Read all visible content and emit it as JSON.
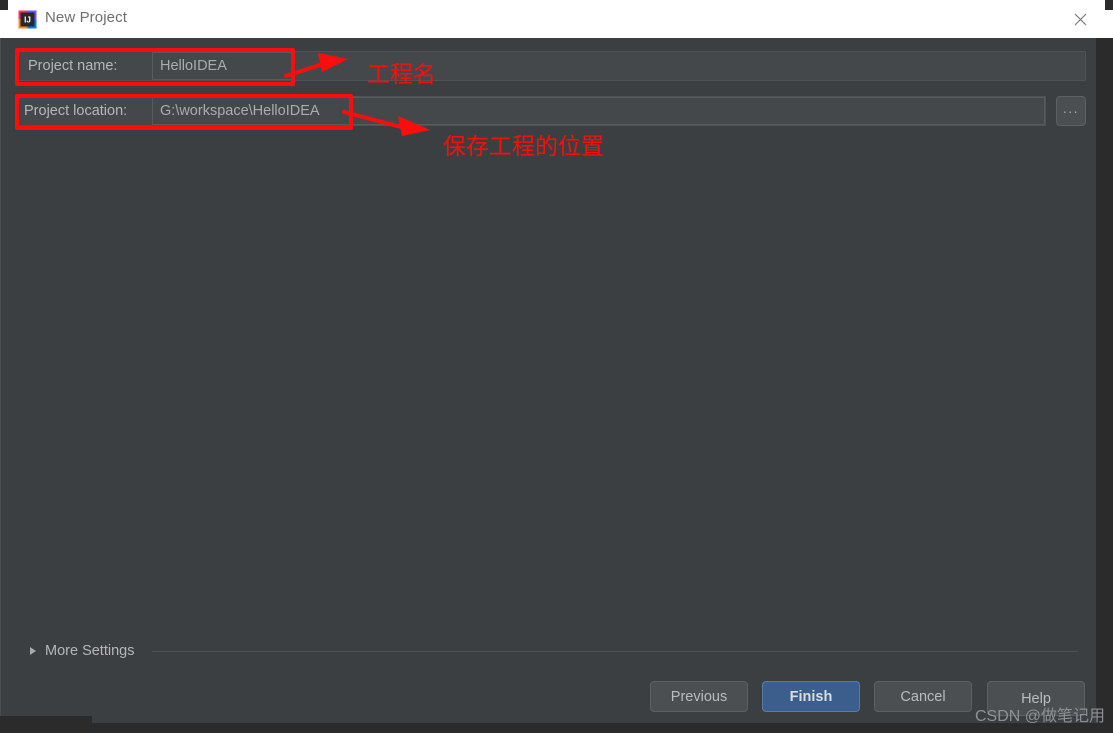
{
  "window": {
    "title": "New Project",
    "app_icon": "intellij-idea-icon",
    "close_icon": "close-icon"
  },
  "form": {
    "project_name": {
      "label": "Project name:",
      "value": "HelloIDEA",
      "placeholder": ""
    },
    "project_location": {
      "label": "Project location:",
      "value": "G:\\workspace\\HelloIDEA",
      "placeholder": "",
      "browse_label": "..."
    }
  },
  "more_settings": {
    "label": "More Settings",
    "expand_icon": "chevron-right-icon",
    "expanded": false
  },
  "buttons": {
    "previous": "Previous",
    "finish": "Finish",
    "cancel": "Cancel",
    "help": "Help"
  },
  "annotations": [
    {
      "id": "project-name-annotation",
      "text": "工程名"
    },
    {
      "id": "project-location-annotation",
      "text": "保存工程的位置"
    }
  ],
  "watermark": "CSDN @做笔记用",
  "colors": {
    "dialog_bg": "#3c3f41",
    "titlebar_bg": "#ffffff",
    "field_bg": "#45484a",
    "accent_primary": "#3c5e8c",
    "annotation_red": "#fc0d0d",
    "outer_bg": "#2b2b2b"
  }
}
